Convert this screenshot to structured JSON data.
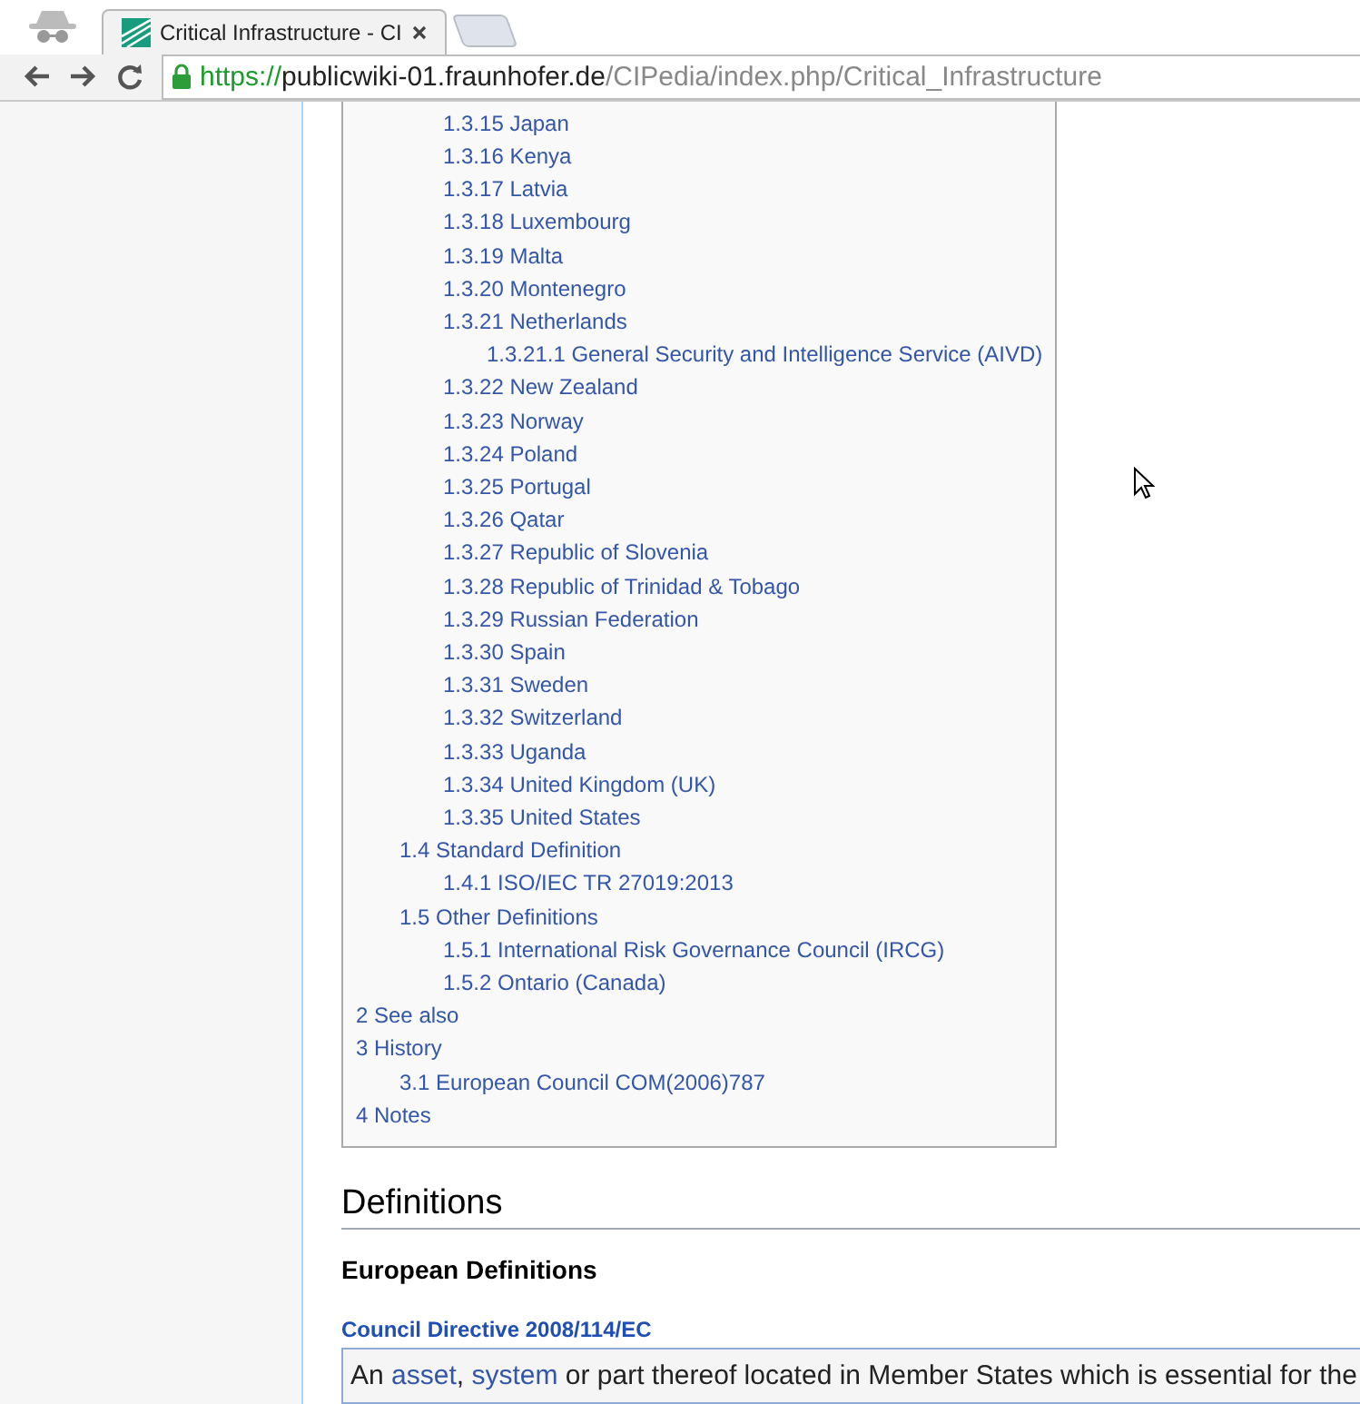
{
  "browser": {
    "tab": {
      "title": "Critical Infrastructure - CI",
      "selected": true
    },
    "url": {
      "scheme": "https://",
      "host": "publicwiki-01.fraunhofer.de",
      "path": "/CIPedia/index.php/Critical_Infrastructure"
    }
  },
  "toc": [
    {
      "children": [
        {
          "children": [
            {
              "label": "1.3.15 Japan"
            },
            {
              "label": "1.3.16 Kenya"
            },
            {
              "label": "1.3.17 Latvia"
            },
            {
              "label": "1.3.18 Luxembourg"
            },
            {
              "label": "1.3.19 Malta"
            },
            {
              "label": "1.3.20 Montenegro"
            },
            {
              "label": "1.3.21 Netherlands",
              "children": [
                {
                  "label": "1.3.21.1 General Security and Intelligence Service (AIVD)"
                }
              ]
            },
            {
              "label": "1.3.22 New Zealand"
            },
            {
              "label": "1.3.23 Norway"
            },
            {
              "label": "1.3.24 Poland"
            },
            {
              "label": "1.3.25 Portugal"
            },
            {
              "label": "1.3.26 Qatar"
            },
            {
              "label": "1.3.27 Republic of Slovenia"
            },
            {
              "label": "1.3.28 Republic of Trinidad & Tobago"
            },
            {
              "label": "1.3.29 Russian Federation"
            },
            {
              "label": "1.3.30 Spain"
            },
            {
              "label": "1.3.31 Sweden"
            },
            {
              "label": "1.3.32 Switzerland"
            },
            {
              "label": "1.3.33 Uganda"
            },
            {
              "label": "1.3.34 United Kingdom (UK)"
            },
            {
              "label": "1.3.35 United States"
            }
          ]
        },
        {
          "label": "1.4 Standard Definition",
          "children": [
            {
              "label": "1.4.1 ISO/IEC TR 27019:2013"
            }
          ]
        },
        {
          "label": "1.5 Other Definitions",
          "children": [
            {
              "label": "1.5.1 International Risk Governance Council (IRCG)"
            },
            {
              "label": "1.5.2 Ontario (Canada)"
            }
          ]
        }
      ]
    },
    {
      "label": "2 See also"
    },
    {
      "label": "3 History",
      "children": [
        {
          "label": "3.1 European Council COM(2006)787"
        }
      ]
    },
    {
      "label": "4 Notes"
    }
  ],
  "section": {
    "heading": "Definitions",
    "subheading": "European Definitions",
    "source": "Council Directive 2008/114/EC",
    "quote": [
      {
        "text": "An ",
        "link": false
      },
      {
        "text": "asset",
        "link": true
      },
      {
        "text": ", ",
        "link": false
      },
      {
        "text": "system",
        "link": true
      },
      {
        "text": " or part thereof located in Member States which is essential for the",
        "link": false
      }
    ]
  }
}
